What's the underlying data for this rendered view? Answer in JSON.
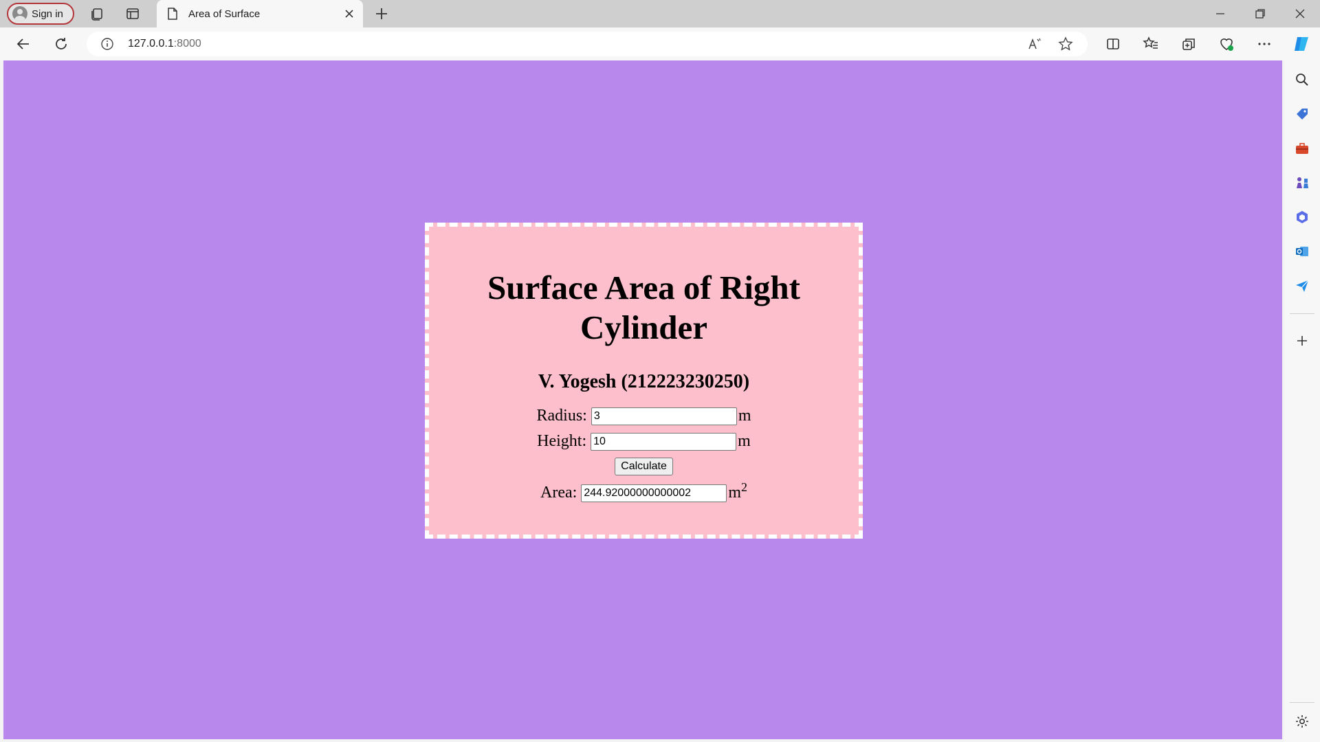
{
  "browser": {
    "signin_label": "Sign in",
    "tab": {
      "title": "Area of Surface"
    },
    "address": {
      "host": "127.0.0.1",
      "port": ":8000"
    }
  },
  "page": {
    "title": "Surface Area of Right Cylinder",
    "author": "V. Yogesh (212223230250)",
    "form": {
      "radius": {
        "label": "Radius:",
        "value": "3",
        "unit": "m"
      },
      "height": {
        "label": "Height:",
        "value": "10",
        "unit": "m"
      },
      "calculate_label": "Calculate",
      "area": {
        "label": "Area:",
        "value": "244.92000000000002",
        "unit": "m",
        "unit_exponent": "2"
      }
    }
  },
  "colors": {
    "page_background": "#b988ec",
    "card_background": "#fdbfcb",
    "card_border": "#ffffff",
    "signin_border": "#b2353a"
  }
}
